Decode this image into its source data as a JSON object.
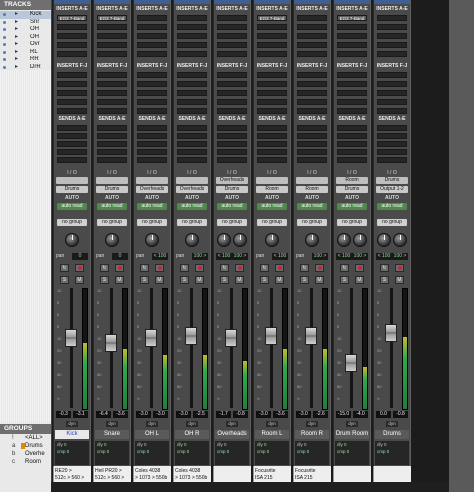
{
  "left_panel": {
    "tracks_header": "TRACKS",
    "tracks": [
      "Kick",
      "Snr",
      "OH",
      "OH",
      "Ovr",
      "RL",
      "RR",
      "DrR",
      "Drm"
    ],
    "groups_header": "GROUPS",
    "groups": [
      {
        "id": "!",
        "name": "<ALL>"
      },
      {
        "id": "a",
        "name": "Drums"
      },
      {
        "id": "b",
        "name": "Overhe"
      },
      {
        "id": "c",
        "name": "Room"
      }
    ]
  },
  "section_labels": {
    "inserts_ae": "INSERTS A-E",
    "inserts_fj": "INSERTS F-J",
    "sends_ae": "SENDS A-E",
    "sends_fj": "SENDS F-J",
    "io": "I / O",
    "auto": "AUTO",
    "auto_mode": "auto read",
    "group": "no group",
    "pan_label": "pan",
    "dyn": "dyn",
    "solo": "S",
    "mute": "M"
  },
  "channels": [
    {
      "name": "Kick",
      "insert": "EQ3 7-Band",
      "input": "",
      "output": "Drums",
      "pan": [
        "0"
      ],
      "volume": "-0.3",
      "peak": "-3.1",
      "meter": 0.55,
      "fader": 0.6,
      "delay": [
        "dly",
        "0",
        "cmp",
        "0"
      ],
      "comment": [
        "RE20 >",
        "512c > 560 >"
      ],
      "selected": true
    },
    {
      "name": "Snare",
      "insert": "EQ3 7-Band",
      "input": "",
      "output": "Drums",
      "pan": [
        "0"
      ],
      "volume": "-6.4",
      "peak": "-3.6",
      "meter": 0.5,
      "fader": 0.55,
      "delay": [
        "dly",
        "0",
        "cmp",
        "0"
      ],
      "comment": [
        "Heil PR20 >",
        "512c > 560 >"
      ],
      "selected": false
    },
    {
      "name": "OH L",
      "insert": "",
      "input": "",
      "output": "Overheads",
      "pan": [
        "< 100"
      ],
      "volume": "-3.0",
      "peak": "-3.0",
      "meter": 0.45,
      "fader": 0.6,
      "delay": [
        "dly",
        "0",
        "cmp",
        "0"
      ],
      "comment": [
        "Coles 4038",
        "> 1073 > 550b"
      ],
      "selected": false
    },
    {
      "name": "OH R",
      "insert": "",
      "input": "",
      "output": "Overheads",
      "pan": [
        "100 >"
      ],
      "volume": "-3.0",
      "peak": "-2.5",
      "meter": 0.45,
      "fader": 0.62,
      "delay": [
        "dly",
        "0",
        "cmp",
        "0"
      ],
      "comment": [
        "Coles 4038",
        "> 1073 > 550b"
      ],
      "selected": false
    },
    {
      "name": "Overheads",
      "insert": "",
      "input": "Overheads",
      "output": "Drums",
      "pan": [
        "< 100",
        "100 >"
      ],
      "volume": "-1.7",
      "peak": "-0.8",
      "meter": 0.4,
      "fader": 0.6,
      "delay": [
        "dly",
        "0",
        "cmp",
        "0"
      ],
      "comment": [],
      "selected": false
    },
    {
      "name": "Room L",
      "insert": "EQ3 7-Band",
      "input": "",
      "output": "Room",
      "pan": [
        "< 100"
      ],
      "volume": "-3.0",
      "peak": "-3.6",
      "meter": 0.5,
      "fader": 0.62,
      "delay": [
        "dly",
        "0",
        "cmp",
        "0"
      ],
      "comment": [
        "Focusrite",
        "ISA 215"
      ],
      "selected": false
    },
    {
      "name": "Room R",
      "insert": "",
      "input": "",
      "output": "Room",
      "pan": [
        "100 >"
      ],
      "volume": "-3.0",
      "peak": "-2.6",
      "meter": 0.5,
      "fader": 0.62,
      "delay": [
        "dly",
        "0",
        "cmp",
        "0"
      ],
      "comment": [
        "Focusrite",
        "ISA 215"
      ],
      "selected": false
    },
    {
      "name": "Drum Room",
      "insert": "EQ3 7-Band",
      "input": "Room",
      "output": "Drums",
      "pan": [
        "< 100",
        "100 >"
      ],
      "volume": "-15.0",
      "peak": "-4.0",
      "meter": 0.35,
      "fader": 0.35,
      "delay": [
        "dly",
        "0",
        "cmp",
        "0"
      ],
      "comment": [],
      "selected": false
    },
    {
      "name": "Drums",
      "insert": "",
      "input": "Drums",
      "output": "Output 1-2",
      "pan": [
        "< 100",
        "100 >"
      ],
      "volume": "0.0",
      "peak": "-0.8",
      "meter": 0.6,
      "fader": 0.65,
      "delay": [
        "dly",
        "0",
        "cmp",
        "0"
      ],
      "comment": [],
      "selected": false
    }
  ]
}
